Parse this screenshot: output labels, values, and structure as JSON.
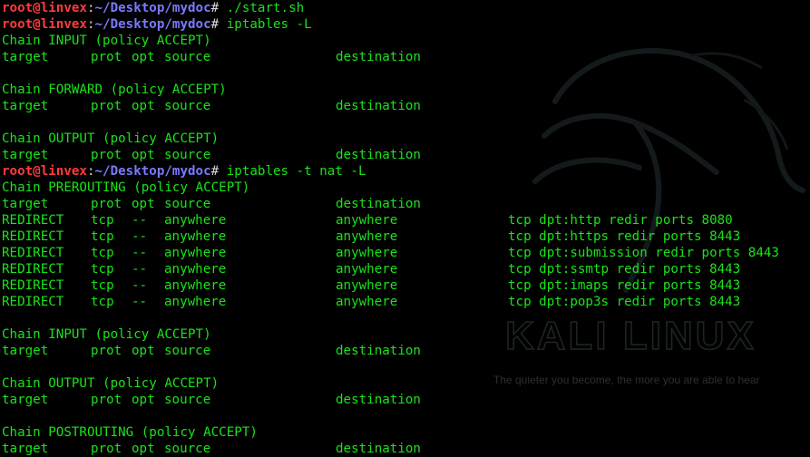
{
  "terminal": {
    "watermark": {
      "title": "KALI LINUX",
      "tagline": "The quieter you become, the more you are able to hear"
    },
    "lines": [
      {
        "type": "prompt",
        "user": "root@linvex",
        "path": "~/Desktop/mydoc",
        "symbol": "#",
        "command": "./start.sh"
      },
      {
        "type": "prompt",
        "user": "root@linvex",
        "path": "~/Desktop/mydoc",
        "symbol": "#",
        "command": "iptables -L"
      },
      {
        "type": "text",
        "text": "Chain INPUT (policy ACCEPT)"
      },
      {
        "type": "header",
        "cols": [
          "target",
          "prot",
          "opt",
          "source",
          "destination",
          ""
        ]
      },
      {
        "type": "blank"
      },
      {
        "type": "text",
        "text": "Chain FORWARD (policy ACCEPT)"
      },
      {
        "type": "header",
        "cols": [
          "target",
          "prot",
          "opt",
          "source",
          "destination",
          ""
        ]
      },
      {
        "type": "blank"
      },
      {
        "type": "text",
        "text": "Chain OUTPUT (policy ACCEPT)"
      },
      {
        "type": "header",
        "cols": [
          "target",
          "prot",
          "opt",
          "source",
          "destination",
          ""
        ]
      },
      {
        "type": "prompt",
        "user": "root@linvex",
        "path": "~/Desktop/mydoc",
        "symbol": "#",
        "command": "iptables -t nat -L"
      },
      {
        "type": "text",
        "text": "Chain PREROUTING (policy ACCEPT)"
      },
      {
        "type": "header",
        "cols": [
          "target",
          "prot",
          "opt",
          "source",
          "destination",
          ""
        ]
      },
      {
        "type": "rule",
        "cols": [
          "REDIRECT",
          "tcp",
          "--",
          "anywhere",
          "anywhere",
          "tcp dpt:http redir ports 8080"
        ]
      },
      {
        "type": "rule",
        "cols": [
          "REDIRECT",
          "tcp",
          "--",
          "anywhere",
          "anywhere",
          "tcp dpt:https redir ports 8443"
        ]
      },
      {
        "type": "rule",
        "cols": [
          "REDIRECT",
          "tcp",
          "--",
          "anywhere",
          "anywhere",
          "tcp dpt:submission redir ports 8443"
        ]
      },
      {
        "type": "rule",
        "cols": [
          "REDIRECT",
          "tcp",
          "--",
          "anywhere",
          "anywhere",
          "tcp dpt:ssmtp redir ports 8443"
        ]
      },
      {
        "type": "rule",
        "cols": [
          "REDIRECT",
          "tcp",
          "--",
          "anywhere",
          "anywhere",
          "tcp dpt:imaps redir ports 8443"
        ]
      },
      {
        "type": "rule",
        "cols": [
          "REDIRECT",
          "tcp",
          "--",
          "anywhere",
          "anywhere",
          "tcp dpt:pop3s redir ports 8443"
        ]
      },
      {
        "type": "blank"
      },
      {
        "type": "text",
        "text": "Chain INPUT (policy ACCEPT)"
      },
      {
        "type": "header",
        "cols": [
          "target",
          "prot",
          "opt",
          "source",
          "destination",
          ""
        ]
      },
      {
        "type": "blank"
      },
      {
        "type": "text",
        "text": "Chain OUTPUT (policy ACCEPT)"
      },
      {
        "type": "header",
        "cols": [
          "target",
          "prot",
          "opt",
          "source",
          "destination",
          ""
        ]
      },
      {
        "type": "blank"
      },
      {
        "type": "text",
        "text": "Chain POSTROUTING (policy ACCEPT)"
      },
      {
        "type": "header",
        "cols": [
          "target",
          "prot",
          "opt",
          "source",
          "destination",
          ""
        ]
      }
    ]
  },
  "colors": {
    "background": "#000000",
    "text": "#1ae31a",
    "prompt_user": "#ff3b3b",
    "prompt_path": "#7a7aff",
    "prompt_separator": "#d9d9d9"
  }
}
